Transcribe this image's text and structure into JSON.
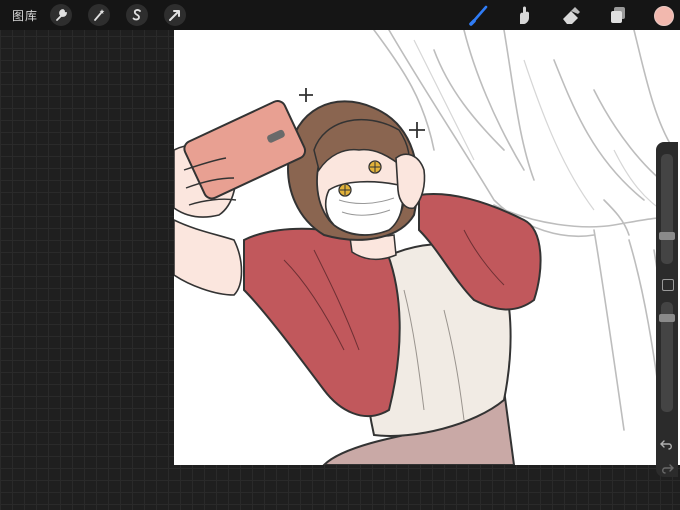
{
  "toolbar": {
    "gallery_label": "图库",
    "left_tools": [
      {
        "name": "actions",
        "icon": "wrench-icon"
      },
      {
        "name": "adjustments",
        "icon": "magic-wand-icon"
      },
      {
        "name": "selection",
        "icon": "selection-s-icon"
      },
      {
        "name": "transform",
        "icon": "arrow-cursor-icon"
      }
    ],
    "right_tools": [
      {
        "name": "brush",
        "icon": "brush-icon",
        "active": true
      },
      {
        "name": "smudge",
        "icon": "smudge-finger-icon"
      },
      {
        "name": "eraser",
        "icon": "eraser-icon"
      },
      {
        "name": "layers",
        "icon": "layers-icon"
      }
    ],
    "current_color": "#f2b8ae",
    "active_tool_color": "#2f7cf6"
  },
  "canvas": {
    "artwork": "illustration-selfie-girl",
    "colors": {
      "phone": "#e8a092",
      "shirt_red": "#c1585c",
      "shirt_cream": "#f1ebe4",
      "hair": "#8a6550",
      "skirt": "#c9a9a6",
      "skin": "#fbe6de"
    }
  },
  "sidebar": {
    "brush_size_level": 0.25,
    "opacity_level": 0.3
  }
}
